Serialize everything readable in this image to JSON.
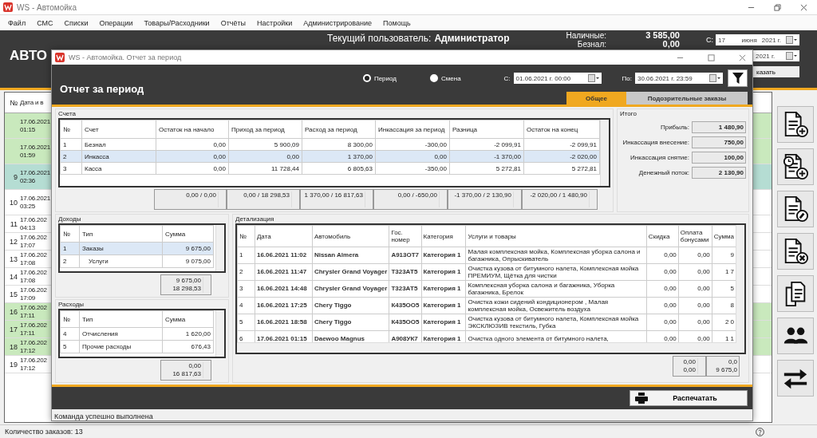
{
  "window": {
    "title": "WS - Автомойка"
  },
  "menu": [
    "Файл",
    "СМС",
    "Списки",
    "Операции",
    "Товары/Расходники",
    "Отчёты",
    "Настройки",
    "Администрирование",
    "Помощь"
  ],
  "header": {
    "brand": "АВТО",
    "user_label": "Текущий пользователь:",
    "user": "Администратор",
    "cash_label": "Наличные:",
    "cash": "3 585,00",
    "noncash_label": "Безнал:",
    "noncash": "0,00",
    "from_label": "С:",
    "from_day": "17",
    "from_month": "июня",
    "from_year": "2021 г.",
    "to_year": "2021 г.",
    "show_button": "казать"
  },
  "orders": {
    "columns": [
      "№",
      "Дата и в"
    ],
    "rows": [
      {
        "date": "17.06.2021",
        "time": "01:15",
        "color": "#c9e9bd"
      },
      {
        "date": "17.06.2021",
        "time": "01:59",
        "color": "#c9e9bd"
      },
      {
        "number": "9",
        "date": "17.06.2021",
        "time": "02:36",
        "color": "#b5ddd3"
      },
      {
        "number": "10",
        "date": "17.06.2021",
        "time": "03:25",
        "color": "#ffffff"
      },
      {
        "number": "11",
        "date": "17.06.202",
        "time": "04:13",
        "color": "#ffffff"
      },
      {
        "number": "12",
        "date": "17.06.202",
        "time": "17:07",
        "color": "#ffffff"
      },
      {
        "number": "13",
        "date": "17.06.202",
        "time": "17:08",
        "color": "#ffffff"
      },
      {
        "number": "14",
        "date": "17.06.202",
        "time": "17:08",
        "color": "#ffffff"
      },
      {
        "number": "15",
        "date": "17.06.202",
        "time": "17:09",
        "color": "#ffffff"
      },
      {
        "number": "16",
        "date": "17.06.202",
        "time": "17:11",
        "color": "#c9e9bd"
      },
      {
        "number": "17",
        "date": "17.06.202",
        "time": "17:11",
        "color": "#c9e9bd"
      },
      {
        "number": "18",
        "date": "17.06.202",
        "time": "17:12",
        "color": "#c9e9bd"
      },
      {
        "number": "19",
        "date": "17.06.202",
        "time": "17:12",
        "color": "#ffffff"
      }
    ]
  },
  "status_bar": "Количество заказов: 13",
  "report": {
    "title": "WS - Автомойка. Отчет за период",
    "heading": "Отчет за период",
    "modes": [
      {
        "label": "Период",
        "selected": true
      },
      {
        "label": "Смена",
        "selected": false
      }
    ],
    "from_label": "С:",
    "from": "01.06.2021 г. 00:00",
    "to_label": "По:",
    "to": "30.06.2021 г. 23:59",
    "tabs": [
      {
        "label": "Общее",
        "selected": true
      },
      {
        "label": "Подозрительные заказы",
        "selected": false
      }
    ],
    "accounts": {
      "title": "Счета",
      "columns": [
        "№",
        "Счет",
        "Остаток на начало",
        "Приход за период",
        "Расход за период",
        "Инкассация за период",
        "Разница",
        "Остаток на конец"
      ],
      "rows": [
        {
          "cells": [
            "1",
            "Безнал",
            "0,00",
            "5 900,09",
            "8 300,00",
            "-300,00",
            "-2 099,91",
            "-2 099,91"
          ],
          "selected": false
        },
        {
          "cells": [
            "2",
            "Инкасса",
            "0,00",
            "0,00",
            "1 370,00",
            "0,00",
            "-1 370,00",
            "-2 020,00"
          ],
          "selected": true
        },
        {
          "cells": [
            "3",
            "Касса",
            "0,00",
            "11 728,44",
            "6 805,63",
            "-350,00",
            "5 272,81",
            "5 272,81"
          ],
          "selected": false
        }
      ],
      "totals": [
        "0,00 / 0,00",
        "0,00 / 18 298,53",
        "1 370,00 / 16 817,63",
        "0,00 / -650,00",
        "-1 370,00 / 2 130,90",
        "-2 020,00 / 1 480,90"
      ]
    },
    "summary": {
      "title": "Итого",
      "items": [
        {
          "label": "Прибыль:",
          "value": "1 480,90"
        },
        {
          "label": "Инкассация внесение:",
          "value": "750,00"
        },
        {
          "label": "Инкассация снятие:",
          "value": "100,00"
        },
        {
          "label": "Денежный поток:",
          "value": "2 130,90"
        }
      ]
    },
    "income": {
      "title": "Доходы",
      "columns": [
        "№",
        "Тип",
        "Сумма"
      ],
      "rows": [
        {
          "cells": [
            "1",
            "Заказы",
            "9 675,00"
          ],
          "selected": true,
          "children": [
            {
              "cells": [
                "2",
                "Услуги",
                "9 075,00"
              ],
              "selected": false
            }
          ]
        }
      ],
      "totals": [
        "9 675,00",
        "18 298,53"
      ]
    },
    "expenses": {
      "title": "Расходы",
      "columns": [
        "№",
        "Тип",
        "Сумма"
      ],
      "rows": [
        {
          "cells": [
            "4",
            "Отчисления",
            "1 620,00"
          ],
          "selected": false
        },
        {
          "cells": [
            "5",
            "Прочие расходы",
            "676,43"
          ],
          "selected": false
        }
      ],
      "totals": [
        "0,00",
        "16 817,63"
      ]
    },
    "details": {
      "title": "Детализация",
      "columns": [
        "№",
        "Дата",
        "Автомобиль",
        "Гос. номер",
        "Категория",
        "Услуги и товары",
        "Скидка",
        "Оплата бонусами",
        "Сумма"
      ],
      "rows": [
        {
          "cells": [
            "1",
            "16.06.2021 11:02",
            "Nissan Almera",
            "А913ОТ7",
            "Категория 1",
            "Малая комплексная мойка, Комплексная уборка салона и багажника, Опрыскиватель",
            "0,00",
            "0,00",
            "9"
          ]
        },
        {
          "cells": [
            "2",
            "16.06.2021 11:47",
            "Chrysler Grand Voyager",
            "Т323АТ5",
            "Категория 1",
            "Очистка кузова от битумного налета, Комплексная мойка ПРЕМИУМ, Щётка для чистки",
            "0,00",
            "0,00",
            "1 7"
          ]
        },
        {
          "cells": [
            "3",
            "16.06.2021 14:48",
            "Chrysler Grand Voyager",
            "Т323АТ5",
            "Категория 1",
            "Комплексная уборка салона и багажника, Уборка багажника, Брелок",
            "0,00",
            "0,00",
            "5"
          ]
        },
        {
          "cells": [
            "4",
            "16.06.2021 17:25",
            "Chery Tiggo",
            "К435ОО5",
            "Категория 1",
            "Очистка кожи сидений кондиционером , Малая комплексная мойка, Освежитель воздуха",
            "0,00",
            "0,00",
            "8"
          ]
        },
        {
          "cells": [
            "5",
            "16.06.2021 18:58",
            "Chery Tiggo",
            "К435ОО5",
            "Категория 1",
            "Очистка кузова от битумного налета, Комплексная мойка ЭКСКЛЮЗИВ текстиль, Губка",
            "0,00",
            "0,00",
            "2 0"
          ]
        },
        {
          "cells": [
            "6",
            "17.06.2021 01:15",
            "Daewoo Magnus",
            "А908УК7",
            "Категория 1",
            "Очистка одного элемента от битумного налета,",
            "0,00",
            "0,00",
            "1 1"
          ]
        }
      ],
      "totals": [
        [
          "0,00",
          "0,00"
        ],
        [
          "0,0",
          "9 675,0"
        ]
      ]
    },
    "print_button": "Распечатать",
    "status": "Команда успешно выполнена"
  }
}
